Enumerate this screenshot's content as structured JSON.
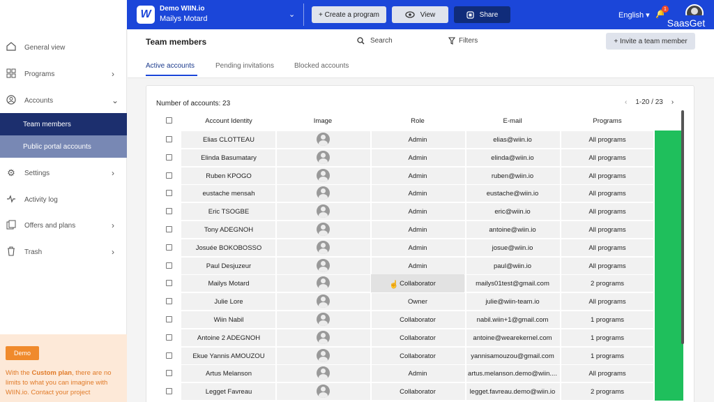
{
  "header": {
    "logo_letter": "W",
    "org_name": "Demo WIIN.io",
    "org_user": "Mailys Motard",
    "create_label": "+ Create a program",
    "view_label": "View",
    "share_label": "Share",
    "language": "English ▾",
    "notif_count": "1",
    "watermark": "SaasGet"
  },
  "sidebar": {
    "items": [
      {
        "label": "General view",
        "icon": "home-icon"
      },
      {
        "label": "Programs",
        "icon": "grid-icon"
      },
      {
        "label": "Accounts",
        "icon": "user-circle-icon"
      },
      {
        "label": "Settings",
        "icon": "gear-icon"
      },
      {
        "label": "Activity log",
        "icon": "activity-icon"
      },
      {
        "label": "Offers and plans",
        "icon": "copy-icon"
      },
      {
        "label": "Trash",
        "icon": "trash-icon"
      }
    ],
    "sub_items": [
      "Team members",
      "Public portal accounts"
    ],
    "promo": {
      "badge": "Demo",
      "text_pre": "With the ",
      "text_bold": "Custom plan",
      "text_post": ", there are no limits to what you can imagine with WIIN.io. Contact your project"
    }
  },
  "page": {
    "title": "Team members",
    "search_label": "Search",
    "filters_label": "Filters",
    "invite_label": "+ Invite a team member",
    "tabs": [
      "Active accounts",
      "Pending invitations",
      "Blocked accounts"
    ]
  },
  "table": {
    "count_label": "Number of accounts: 23",
    "pager": "1-20 / 23",
    "columns": [
      "Account Identity",
      "Image",
      "Role",
      "E-mail",
      "Programs"
    ],
    "rows": [
      {
        "name": "Elias CLOTTEAU",
        "role": "Admin",
        "email": "elias@wiin.io",
        "programs": "All programs"
      },
      {
        "name": "Elinda Basumatary",
        "role": "Admin",
        "email": "elinda@wiin.io",
        "programs": "All programs"
      },
      {
        "name": "Ruben KPOGO",
        "role": "Admin",
        "email": "ruben@wiin.io",
        "programs": "All programs"
      },
      {
        "name": "eustache mensah",
        "role": "Admin",
        "email": "eustache@wiin.io",
        "programs": "All programs"
      },
      {
        "name": "Eric TSOGBE",
        "role": "Admin",
        "email": "eric@wiin.io",
        "programs": "All programs"
      },
      {
        "name": "Tony ADEGNOH",
        "role": "Admin",
        "email": "antoine@wiin.io",
        "programs": "All programs"
      },
      {
        "name": "Josuée BOKOBOSSO",
        "role": "Admin",
        "email": "josue@wiin.io",
        "programs": "All programs"
      },
      {
        "name": "Paul Desjuzeur",
        "role": "Admin",
        "email": "paul@wiin.io",
        "programs": "All programs"
      },
      {
        "name": "Mailys Motard",
        "role": "Collaborator",
        "email": "mailys01test@gmail.com",
        "programs": "2 programs"
      },
      {
        "name": "Julie Lore",
        "role": "Owner",
        "email": "julie@wiin-team.io",
        "programs": "All programs"
      },
      {
        "name": "Wiin Nabil",
        "role": "Collaborator",
        "email": "nabil.wiin+1@gmail.com",
        "programs": "1 programs"
      },
      {
        "name": "Antoine 2 ADEGNOH",
        "role": "Collaborator",
        "email": "antoine@wearekernel.com",
        "programs": "1 programs"
      },
      {
        "name": "Ekue Yannis AMOUZOU",
        "role": "Collaborator",
        "email": "yannisamouzou@gmail.com",
        "programs": "1 programs"
      },
      {
        "name": "Artus Melanson",
        "role": "Admin",
        "email": "artus.melanson.demo@wiin....",
        "programs": "All programs"
      },
      {
        "name": "Legget Favreau",
        "role": "Collaborator",
        "email": "legget.favreau.demo@wiin.io",
        "programs": "2 programs"
      }
    ]
  },
  "colors": {
    "brand": "#1b46d9",
    "nav_active": "#1c2f6e",
    "status_green": "#1fbf5c",
    "promo_orange": "#f08a2c"
  }
}
